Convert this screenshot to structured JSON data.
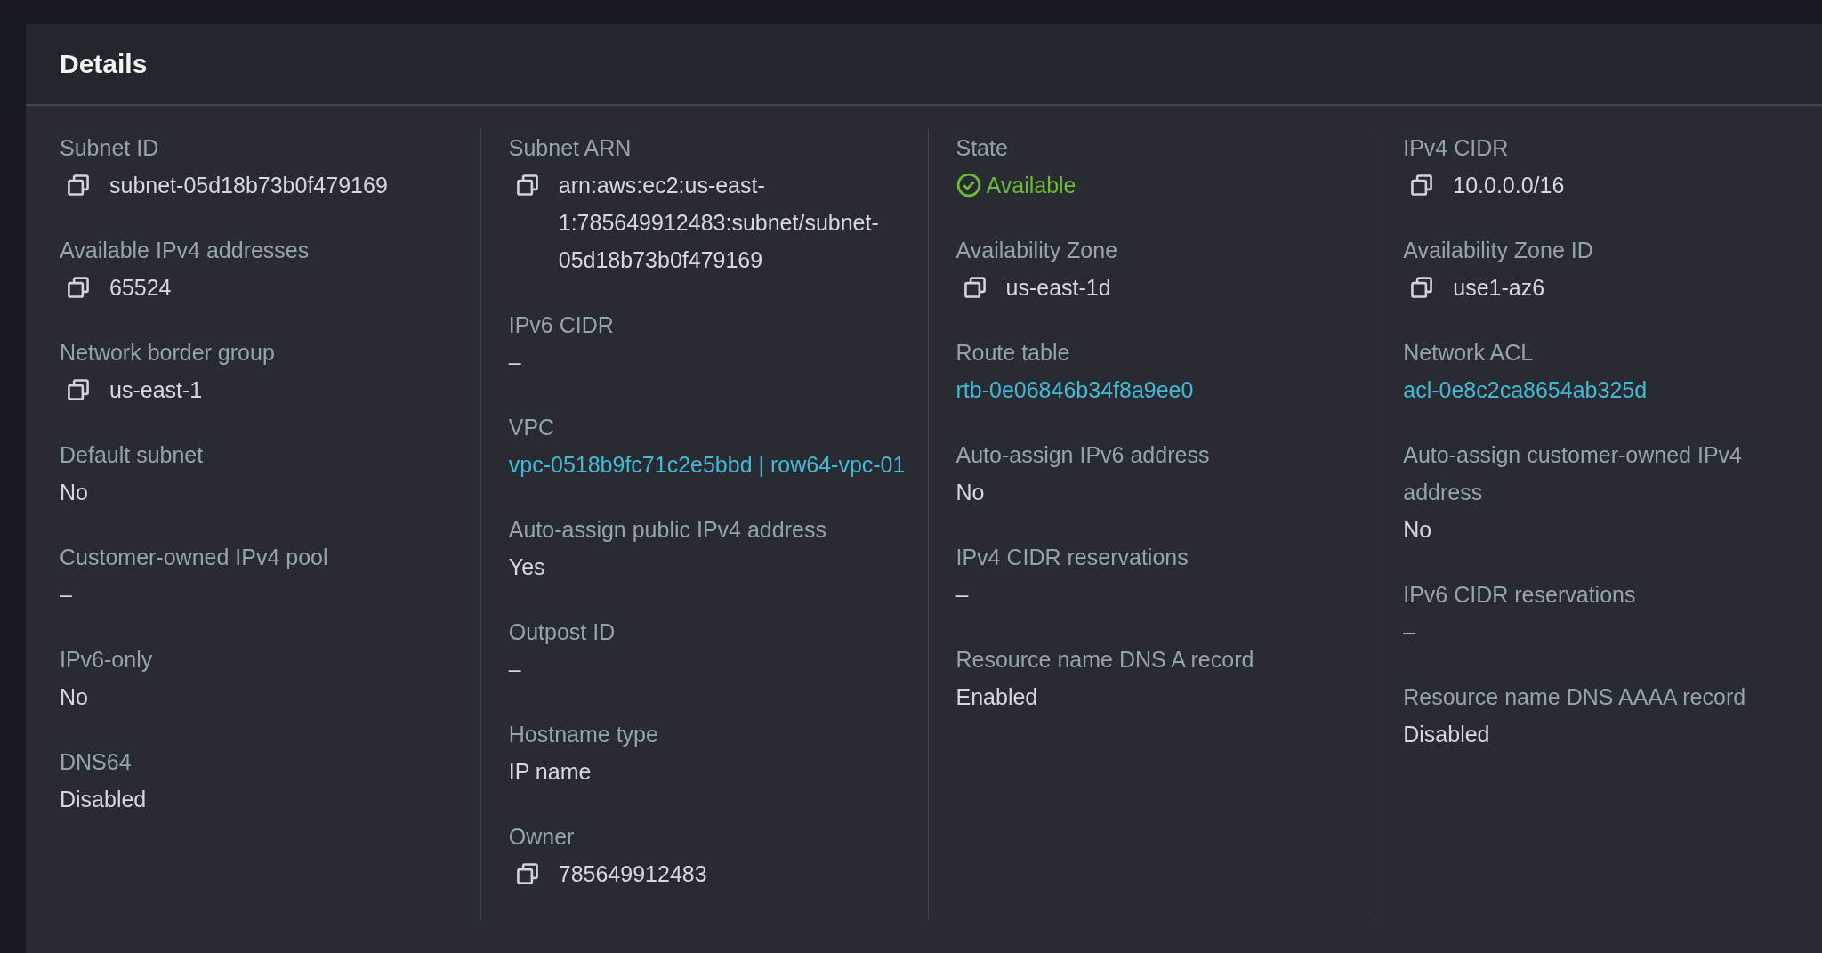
{
  "panel": {
    "title": "Details"
  },
  "columns": [
    {
      "fields": [
        {
          "label": "Subnet ID",
          "kind": "copy",
          "value": "subnet-05d18b73b0f479169"
        },
        {
          "label": "Available IPv4 addresses",
          "kind": "copy",
          "value": "65524"
        },
        {
          "label": "Network border group",
          "kind": "copy",
          "value": "us-east-1"
        },
        {
          "label": "Default subnet",
          "kind": "text",
          "value": "No"
        },
        {
          "label": "Customer-owned IPv4 pool",
          "kind": "text",
          "value": "–"
        },
        {
          "label": "IPv6-only",
          "kind": "text",
          "value": "No"
        },
        {
          "label": "DNS64",
          "kind": "text",
          "value": "Disabled"
        }
      ]
    },
    {
      "fields": [
        {
          "label": "Subnet ARN",
          "kind": "copy",
          "value": "arn:aws:ec2:us-east-1:785649912483:subnet/subnet-05d18b73b0f479169"
        },
        {
          "label": "IPv6 CIDR",
          "kind": "text",
          "value": "–"
        },
        {
          "label": "VPC",
          "kind": "link",
          "value": "vpc-0518b9fc71c2e5bbd | row64-vpc-01"
        },
        {
          "label": "Auto-assign public IPv4 address",
          "kind": "text",
          "value": "Yes"
        },
        {
          "label": "Outpost ID",
          "kind": "text",
          "value": "–"
        },
        {
          "label": "Hostname type",
          "kind": "text",
          "value": "IP name"
        },
        {
          "label": "Owner",
          "kind": "copy",
          "value": "785649912483"
        }
      ]
    },
    {
      "fields": [
        {
          "label": "State",
          "kind": "status",
          "value": "Available"
        },
        {
          "label": "Availability Zone",
          "kind": "copy",
          "value": "us-east-1d"
        },
        {
          "label": "Route table",
          "kind": "link",
          "value": "rtb-0e06846b34f8a9ee0"
        },
        {
          "label": "Auto-assign IPv6 address",
          "kind": "text",
          "value": "No"
        },
        {
          "label": "IPv4 CIDR reservations",
          "kind": "text",
          "value": "–"
        },
        {
          "label": "Resource name DNS A record",
          "kind": "text",
          "value": "Enabled"
        }
      ]
    },
    {
      "fields": [
        {
          "label": "IPv4 CIDR",
          "kind": "copy",
          "value": "10.0.0.0/16"
        },
        {
          "label": "Availability Zone ID",
          "kind": "copy",
          "value": "use1-az6"
        },
        {
          "label": "Network ACL",
          "kind": "link",
          "value": "acl-0e8c2ca8654ab325d"
        },
        {
          "label": "Auto-assign customer-owned IPv4 address",
          "kind": "text",
          "value": "No"
        },
        {
          "label": "IPv6 CIDR reservations",
          "kind": "text",
          "value": "–"
        },
        {
          "label": "Resource name DNS AAAA record",
          "kind": "text",
          "value": "Disabled"
        }
      ]
    }
  ]
}
